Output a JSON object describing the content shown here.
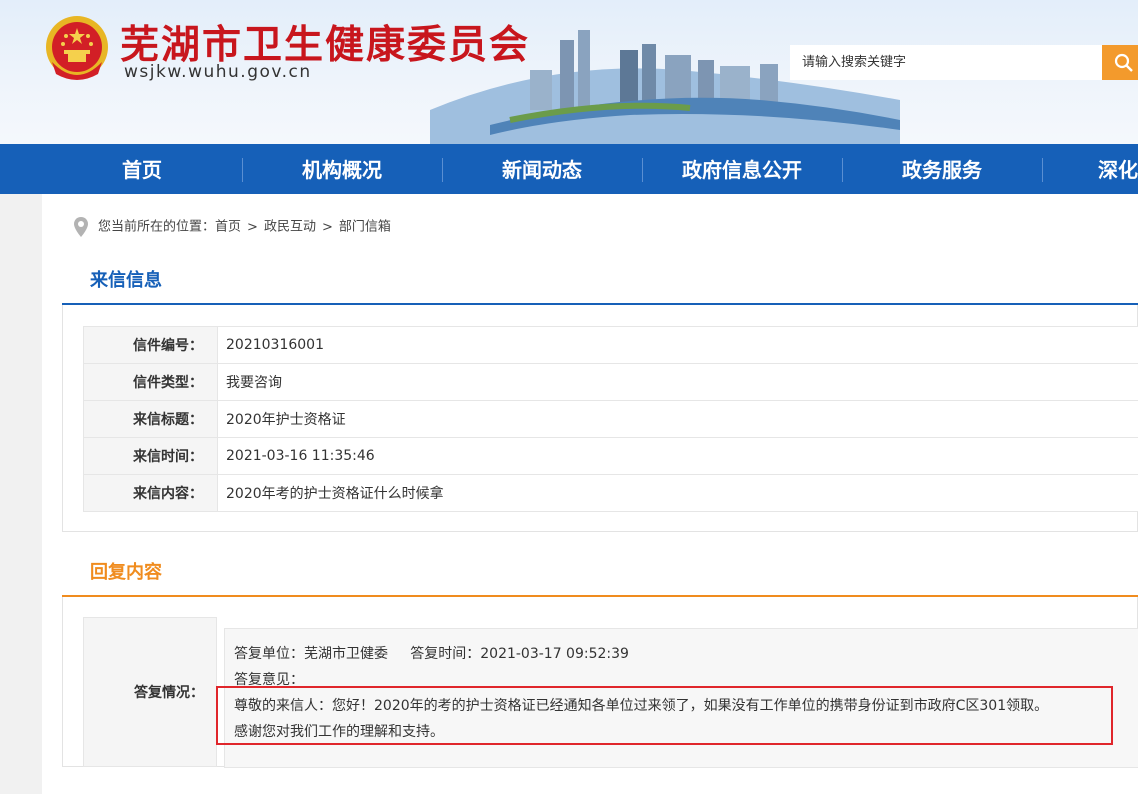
{
  "header": {
    "site_title": "芜湖市卫生健康委员会",
    "site_domain": "wsjkw.wuhu.gov.cn",
    "search_placeholder": "请输入搜索关键字"
  },
  "nav": {
    "items": [
      "首页",
      "机构概况",
      "新闻动态",
      "政府信息公开",
      "政务服务",
      "深化"
    ]
  },
  "breadcrumb": {
    "prefix": "您当前所在的位置：",
    "items": [
      "首页",
      "政民互动",
      "部门信箱"
    ],
    "separator": ">"
  },
  "letter_info": {
    "title": "来信信息",
    "rows": [
      {
        "label": "信件编号：",
        "value": "20210316001"
      },
      {
        "label": "信件类型：",
        "value": "我要咨询"
      },
      {
        "label": "来信标题：",
        "value": "2020年护士资格证"
      },
      {
        "label": "来信时间：",
        "value": "2021-03-16 11:35:46"
      },
      {
        "label": "来信内容：",
        "value": "2020年考的护士资格证什么时候拿"
      }
    ]
  },
  "reply": {
    "title": "回复内容",
    "label": "答复情况：",
    "meta": "答复单位：芜湖市卫健委     答复时间：2021-03-17 09:52:39",
    "opinion_label": "答复意见：",
    "line1": "尊敬的来信人：您好！2020年的考的护士资格证已经通知各单位过来领了，如果没有工作单位的携带身份证到市政府C区301领取。",
    "line2": "感谢您对我们工作的理解和支持。"
  },
  "colors": {
    "brand_red": "#c8161d",
    "nav_blue": "#1660b8",
    "section_blue": "#1660b8",
    "section_orange": "#f08c1e",
    "search_orange": "#f39a2c",
    "highlight_red": "#e0262b"
  }
}
